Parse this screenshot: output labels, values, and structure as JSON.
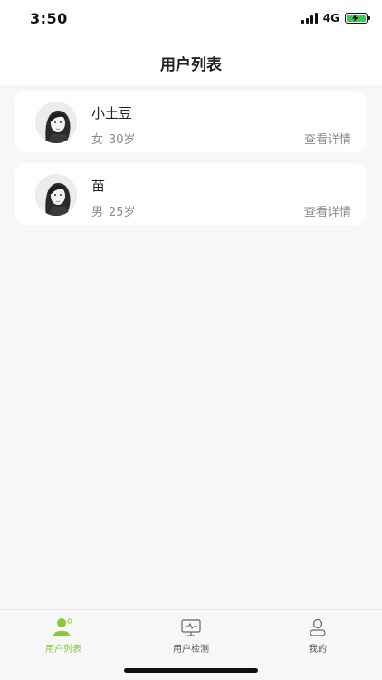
{
  "status_bar": {
    "time": "3:50",
    "network": "4G",
    "battery_color": "#3cc751"
  },
  "header": {
    "title": "用户列表"
  },
  "users": [
    {
      "name": "小土豆",
      "gender": "女",
      "age": "30岁",
      "detail_label": "查看详情"
    },
    {
      "name": "苗",
      "gender": "男",
      "age": "25岁",
      "detail_label": "查看详情"
    }
  ],
  "tabs": [
    {
      "label": "用户列表",
      "icon": "users-icon",
      "active": true
    },
    {
      "label": "用户检测",
      "icon": "monitor-icon",
      "active": false
    },
    {
      "label": "我的",
      "icon": "profile-icon",
      "active": false
    }
  ],
  "colors": {
    "accent": "#8dc63f",
    "background": "#f7f7f7",
    "card": "#ffffff",
    "muted_text": "#8a8a8a"
  }
}
